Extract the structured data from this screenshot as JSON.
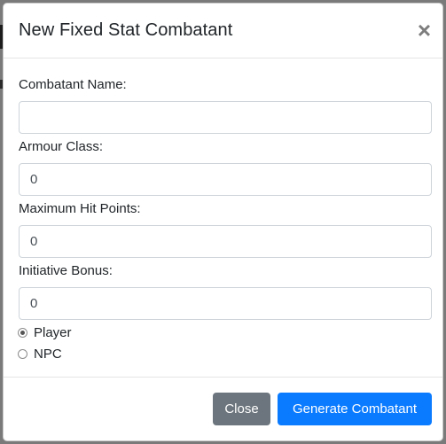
{
  "modal": {
    "title": "New Fixed Stat Combatant",
    "close_symbol": "×"
  },
  "form": {
    "name_label": "Combatant Name:",
    "name_value": "",
    "ac_label": "Armour Class:",
    "ac_value": "0",
    "hp_label": "Maximum Hit Points:",
    "hp_value": "0",
    "init_label": "Initiative Bonus:",
    "init_value": "0",
    "type_options": [
      {
        "label": "Player",
        "checked": true
      },
      {
        "label": "NPC",
        "checked": false
      }
    ]
  },
  "footer": {
    "close_label": "Close",
    "generate_label": "Generate Combatant"
  },
  "colors": {
    "primary": "#0a7bff",
    "secondary": "#6c757d"
  },
  "icons": {
    "close": "close-icon"
  }
}
